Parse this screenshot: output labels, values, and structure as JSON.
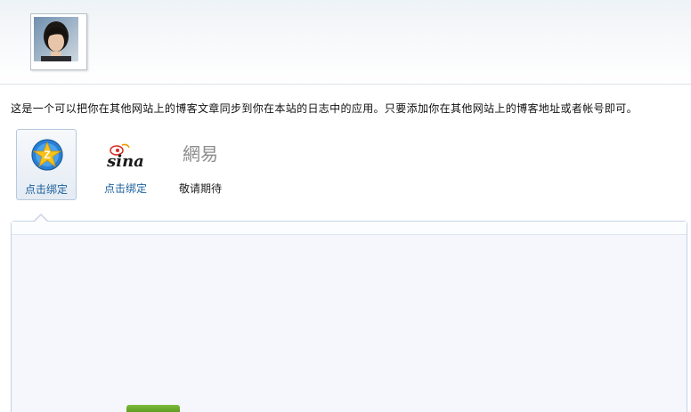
{
  "intro_text": "这是一个可以把你在其他网站上的博客文章同步到你在本站的日志中的应用。只要添加你在其他网站上的博客地址或者帐号即可。",
  "services": [
    {
      "name": "qzone",
      "label": "点击绑定",
      "selected": true
    },
    {
      "name": "sina",
      "label": "点击绑定",
      "selected": false,
      "logo_text": "sina"
    },
    {
      "name": "163",
      "label": "敬请期待",
      "selected": false,
      "logo_text": "網易"
    }
  ],
  "colors": {
    "link": "#1a5e9a",
    "panel_bg": "#f5f7fd",
    "panel_border": "#c5d3e2",
    "sina_red": "#d52b1e",
    "qzone_blue": "#1f6fc4",
    "qzone_gold": "#f5b400"
  }
}
